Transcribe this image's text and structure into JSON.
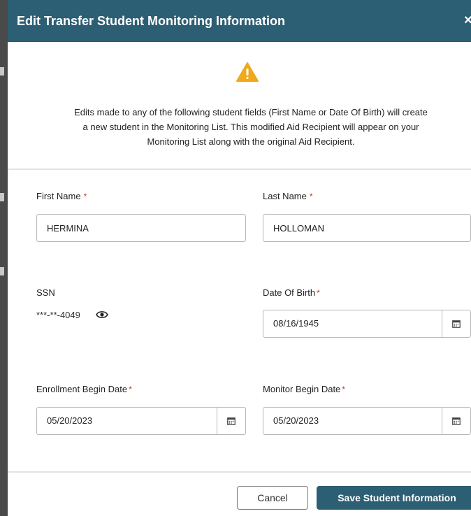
{
  "dialog": {
    "title": "Edit Transfer Student Monitoring Information",
    "close_glyph": "×",
    "warning_icon": "warning-triangle-icon",
    "notice_lines": [
      "Edits made to any of the following student fields (First Name or Date Of Birth) will create",
      "a new student in the Monitoring List. This modified Aid Recipient will appear on your",
      "Monitoring List along with the original Aid Recipient."
    ]
  },
  "form": {
    "required_marker": "*",
    "first_name": {
      "label": "First Name",
      "value": "HERMINA"
    },
    "last_name": {
      "label": "Last Name",
      "value": "HOLLOMAN"
    },
    "ssn": {
      "label": "SSN",
      "value": "***-**-4049",
      "reveal_icon": "eye-icon"
    },
    "date_of_birth": {
      "label": "Date Of Birth",
      "value": "08/16/1945",
      "icon": "calendar-icon"
    },
    "enrollment_begin_date": {
      "label": "Enrollment Begin Date",
      "value": "05/20/2023",
      "icon": "calendar-icon"
    },
    "monitor_begin_date": {
      "label": "Monitor Begin Date",
      "value": "05/20/2023",
      "icon": "calendar-icon"
    }
  },
  "footer": {
    "cancel_label": "Cancel",
    "save_label": "Save Student Information"
  },
  "colors": {
    "header": "#2c5e74",
    "primary_button": "#2c5e74",
    "warning": "#f0a81c",
    "required": "#c0392b"
  }
}
